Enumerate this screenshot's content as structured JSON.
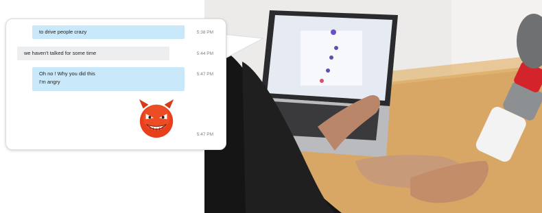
{
  "chat": {
    "messages": [
      {
        "direction": "outgoing",
        "lines": [
          "to drive people crazy"
        ],
        "time": "5:38 PM"
      },
      {
        "direction": "incoming",
        "lines": [
          "we haven't talked for some time"
        ],
        "time": "5:44 PM"
      },
      {
        "direction": "outgoing",
        "lines": [
          "Oh no ! Why you did this",
          "I'm angry"
        ],
        "time": "5:47 PM"
      },
      {
        "direction": "outgoing",
        "emoji": "devil-emoji",
        "time": "5:47 PM"
      }
    ]
  },
  "colors": {
    "outgoing_bubble": "#c9e8fa",
    "incoming_bubble": "#eceef0",
    "timestamp": "#7a7f86",
    "emoji_face": "#e8401c"
  },
  "photo": {
    "subject": "person typing on laptop beside robotic prosthetic hand"
  }
}
